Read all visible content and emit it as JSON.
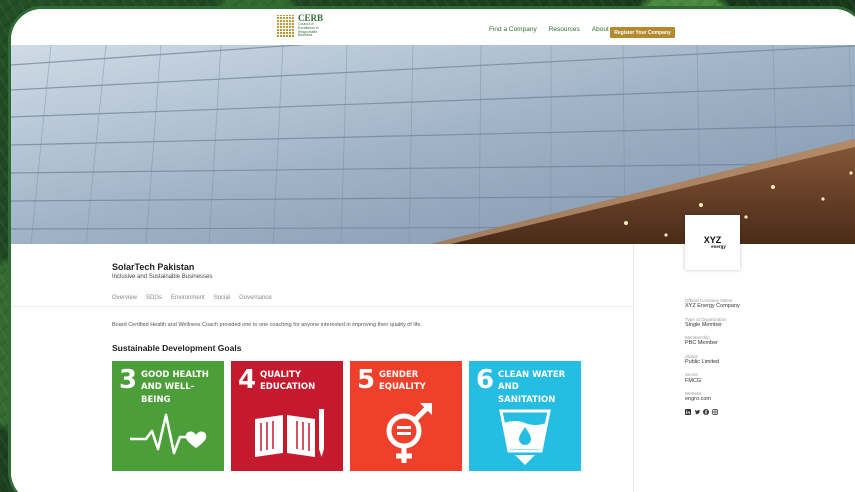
{
  "header": {
    "logo_title": "CERB",
    "logo_subtitle": "Council of Excellence in Responsible Business",
    "nav": [
      "Find a Company",
      "Resources",
      "About"
    ],
    "register_label": "Register Your Company"
  },
  "company": {
    "name": "SolarTech Pakistan",
    "tagline": "Inclusive and Sustainable Businesses",
    "tabs": [
      "Overview",
      "SDGs",
      "Environment",
      "Social",
      "Governance"
    ],
    "description": "Board Certified Health and Wellness Coach provided one to one coaching for anyone interested in improving their quality of life."
  },
  "sdg": {
    "heading": "Sustainable Development Goals",
    "goals": [
      {
        "number": "3",
        "line1": "GOOD HEALTH",
        "line2": "AND WELL-BEING",
        "color": "#4c9f38",
        "icon": "heartbeat-icon"
      },
      {
        "number": "4",
        "line1": "QUALITY",
        "line2": "EDUCATION",
        "color": "#c5192d",
        "icon": "book-pencil-icon"
      },
      {
        "number": "5",
        "line1": "GENDER",
        "line2": "EQUALITY",
        "color": "#ef402b",
        "icon": "gender-equality-icon"
      },
      {
        "number": "6",
        "line1": "CLEAN WATER",
        "line2": "AND SANITATION",
        "color": "#26bde2",
        "icon": "water-glass-icon"
      }
    ]
  },
  "sidebar": {
    "logo_line1": "XYZ",
    "logo_line2": "energy",
    "fields": [
      {
        "label": "Official Company Name",
        "value": "XYZ Energy Company"
      },
      {
        "label": "Type of Organization",
        "value": "Single Member"
      },
      {
        "label": "Membership",
        "value": "PBC Member"
      },
      {
        "label": "Status",
        "value": "Public Limited"
      },
      {
        "label": "Sector",
        "value": "FMCG"
      },
      {
        "label": "Website",
        "value": "engro.com"
      }
    ],
    "socials": [
      "linkedin-icon",
      "twitter-icon",
      "facebook-icon",
      "instagram-icon"
    ]
  },
  "colors": {
    "brand_green": "#2f6b34",
    "accent_gold": "#b5892e"
  }
}
